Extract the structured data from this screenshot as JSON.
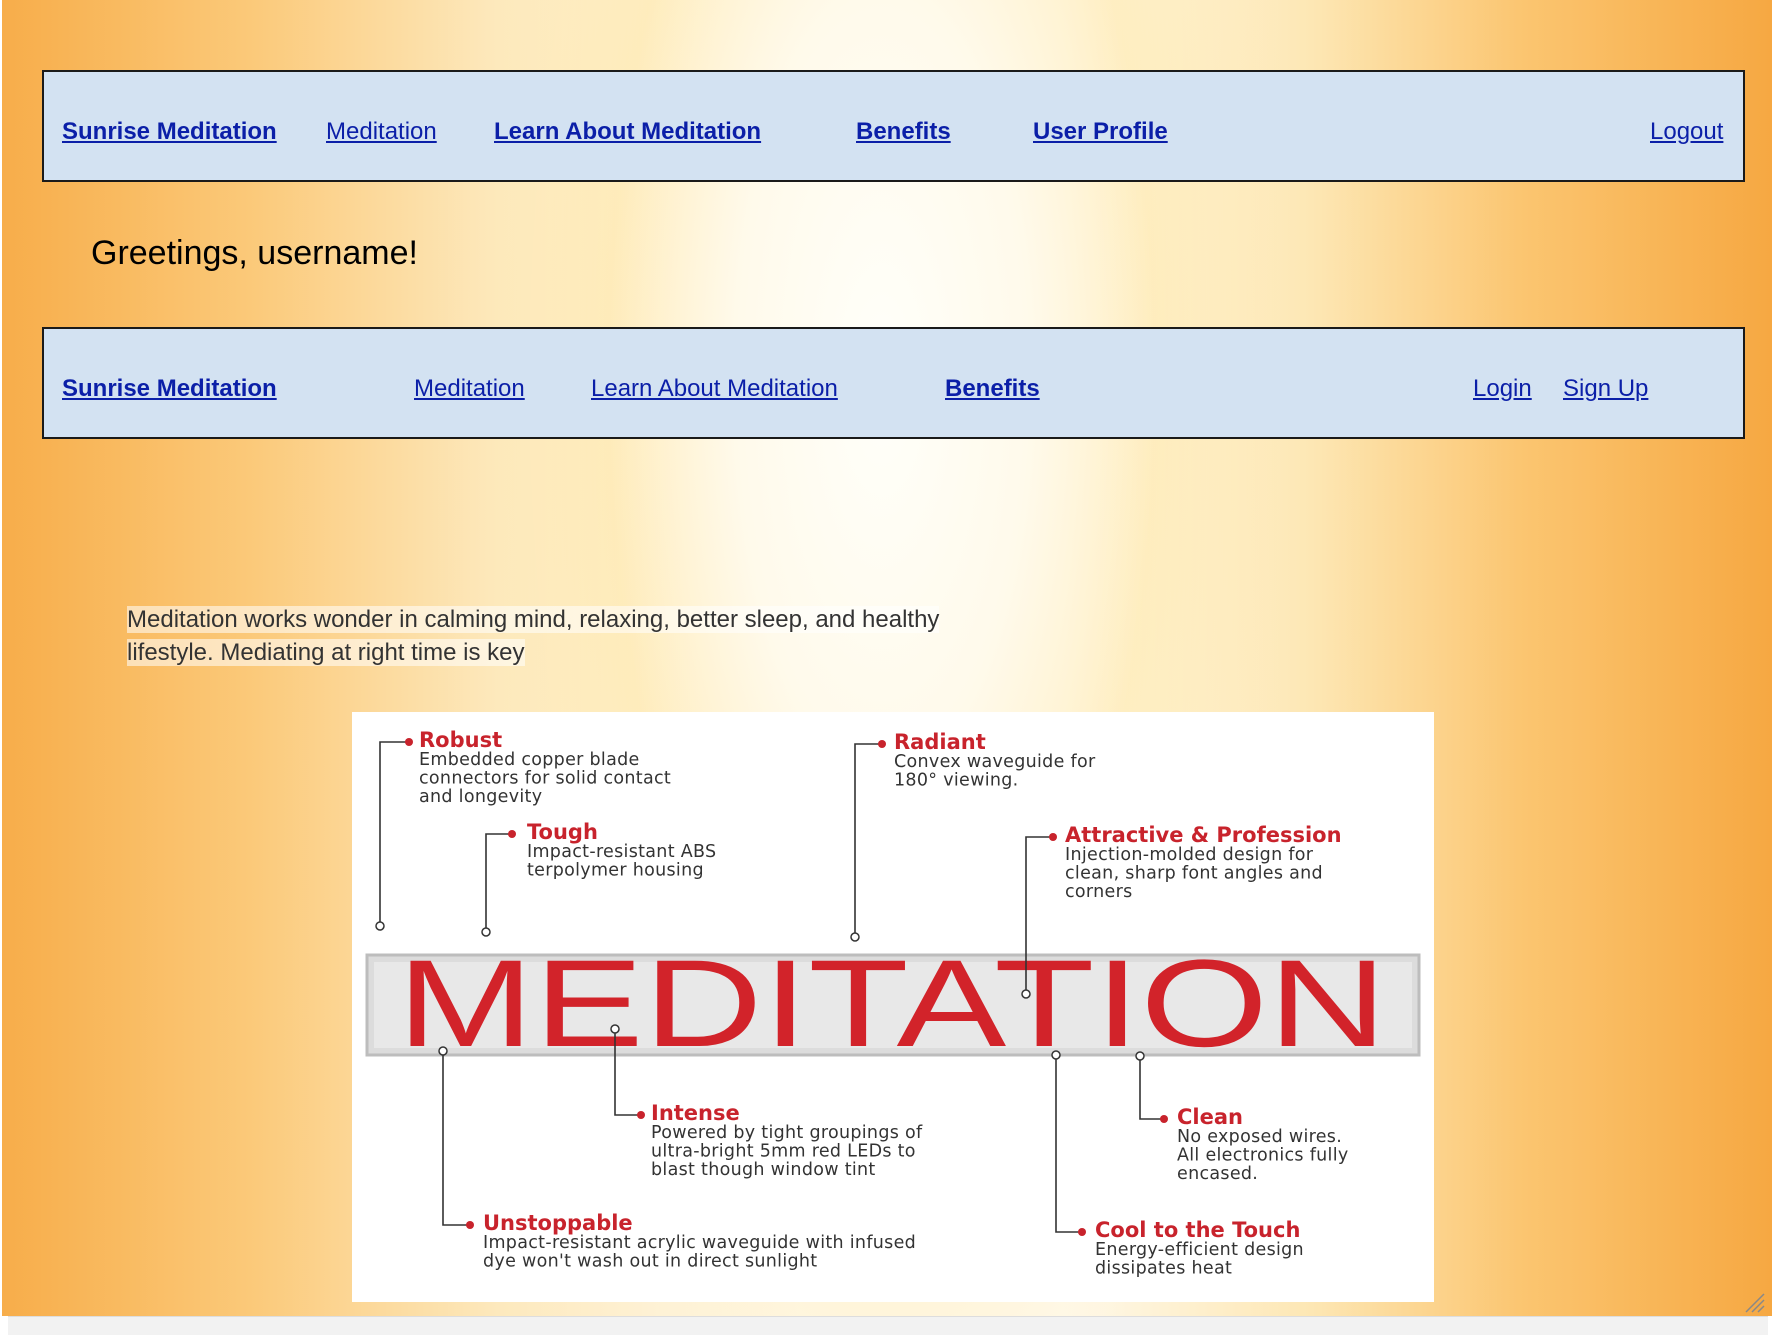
{
  "nav_top": {
    "brand": "Sunrise Meditation",
    "meditation": "Meditation",
    "learn": "Learn About Meditation",
    "benefits": "Benefits",
    "profile": "User Profile",
    "logout": "Logout"
  },
  "greeting": "Greetings, username!",
  "nav_guest": {
    "brand": "Sunrise Meditation",
    "meditation": "Meditation",
    "learn": "Learn About Meditation",
    "benefits": "Benefits",
    "login": "Login",
    "signup": "Sign Up"
  },
  "intro": {
    "line1": "Meditation works wonder in calming mind, relaxing, better sleep, and healthy",
    "line2": "lifestyle. Mediating at right time is key"
  },
  "infographic": {
    "word": "MEDITATION",
    "callouts": [
      {
        "title": "Robust",
        "lines": [
          "Embedded copper blade",
          "connectors for solid contact",
          "and longevity"
        ]
      },
      {
        "title": "Tough",
        "lines": [
          "Impact-resistant ABS",
          "terpolymer housing"
        ]
      },
      {
        "title": "Radiant",
        "lines": [
          "Convex waveguide for",
          "180° viewing."
        ]
      },
      {
        "title": "Attractive & Profession",
        "lines": [
          "Injection-molded design for",
          "clean, sharp font angles and",
          "corners"
        ]
      },
      {
        "title": "Intense",
        "lines": [
          "Powered by tight groupings of",
          "ultra-bright 5mm red LEDs to",
          "blast though window tint"
        ]
      },
      {
        "title": "Clean",
        "lines": [
          "No exposed wires.",
          "All electronics fully",
          "encased."
        ]
      },
      {
        "title": "Unstoppable",
        "lines": [
          "Impact-resistant acrylic waveguide with infused",
          "dye won't wash out in direct sunlight"
        ]
      },
      {
        "title": "Cool to the Touch",
        "lines": [
          "Energy-efficient design",
          "dissipates heat"
        ]
      }
    ],
    "colors": {
      "accent": "#c8232c",
      "text": "#333333",
      "bar": "#d9d9d9"
    }
  },
  "colors": {
    "nav_bg": "#d3e2f2",
    "link": "#0b1fa8"
  },
  "icons": {
    "resize": "resize-grip-icon"
  }
}
